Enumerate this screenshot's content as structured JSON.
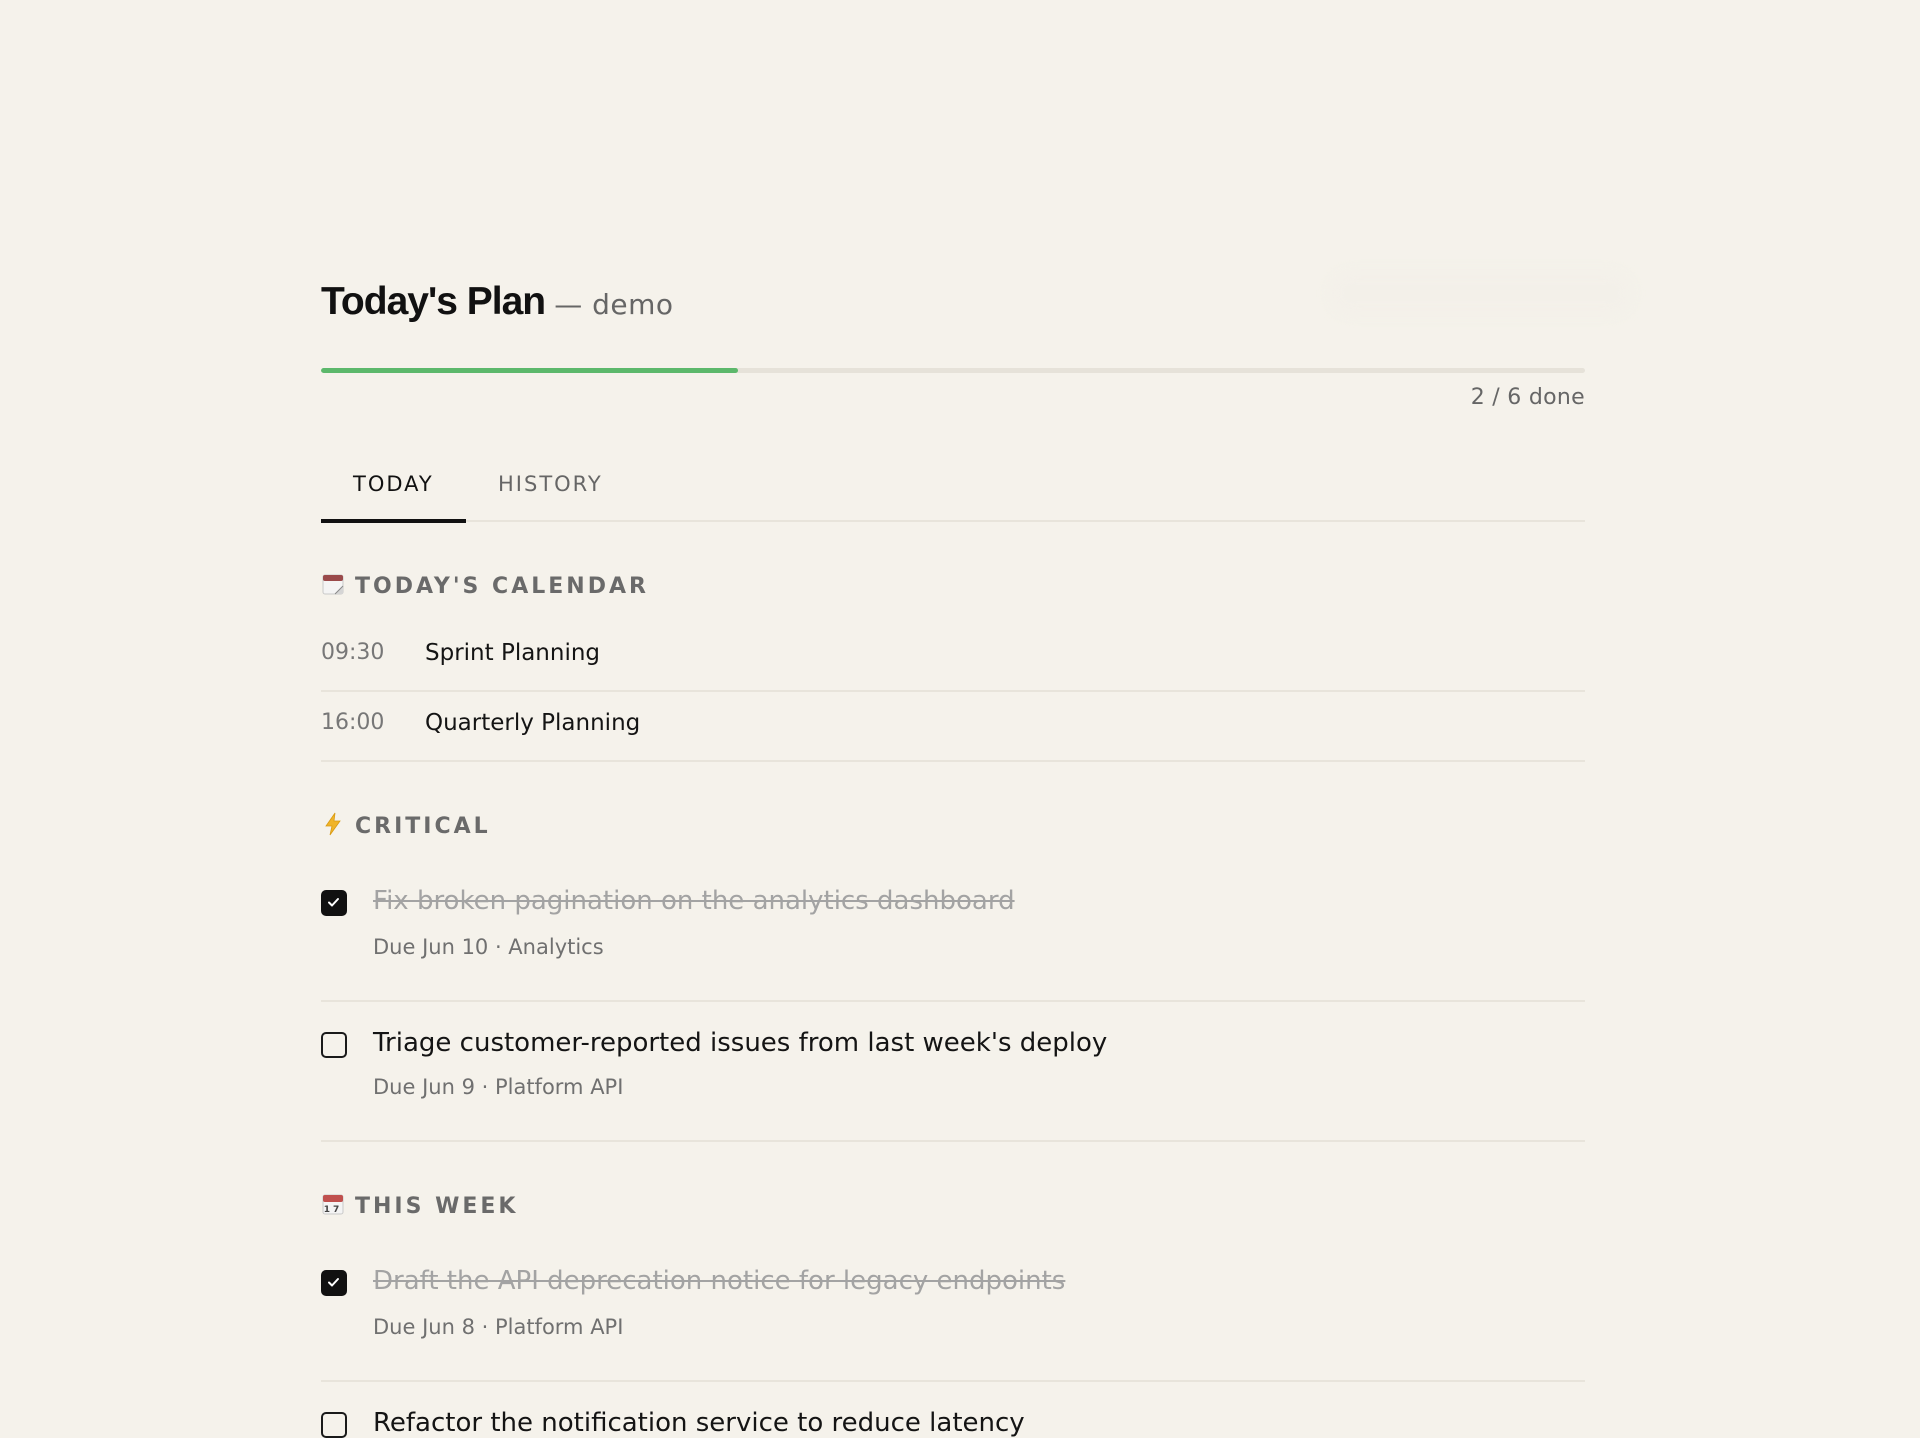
{
  "header": {
    "title": "Today's Plan",
    "subtitle": "— demo"
  },
  "progress": {
    "completed": 2,
    "total": 6,
    "fraction": 0.33,
    "label": "2 / 6 done",
    "fill_color": "#5cb86b"
  },
  "tabs": [
    {
      "label": "TODAY",
      "active": true
    },
    {
      "label": "HISTORY",
      "active": false
    }
  ],
  "calendar": {
    "icon": "tear-off-calendar-icon",
    "heading": "TODAY'S CALENDAR",
    "events": [
      {
        "time": "09:30",
        "title": "Sprint Planning"
      },
      {
        "time": "16:00",
        "title": "Quarterly Planning"
      }
    ]
  },
  "critical": {
    "icon": "lightning-icon",
    "heading": "CRITICAL",
    "tasks": [
      {
        "title": "Fix broken pagination on the analytics dashboard",
        "meta": "Due Jun 10 · Analytics",
        "done": true
      },
      {
        "title": "Triage customer-reported issues from last week's deploy",
        "meta": "Due Jun 9 · Platform API",
        "done": false
      }
    ]
  },
  "this_week": {
    "icon": "calendar-17-icon",
    "heading": "THIS WEEK",
    "tasks": [
      {
        "title": "Draft the API deprecation notice for legacy endpoints",
        "meta": "Due Jun 8 · Platform API",
        "done": true
      },
      {
        "title": "Refactor the notification service to reduce latency",
        "done": false
      }
    ]
  }
}
